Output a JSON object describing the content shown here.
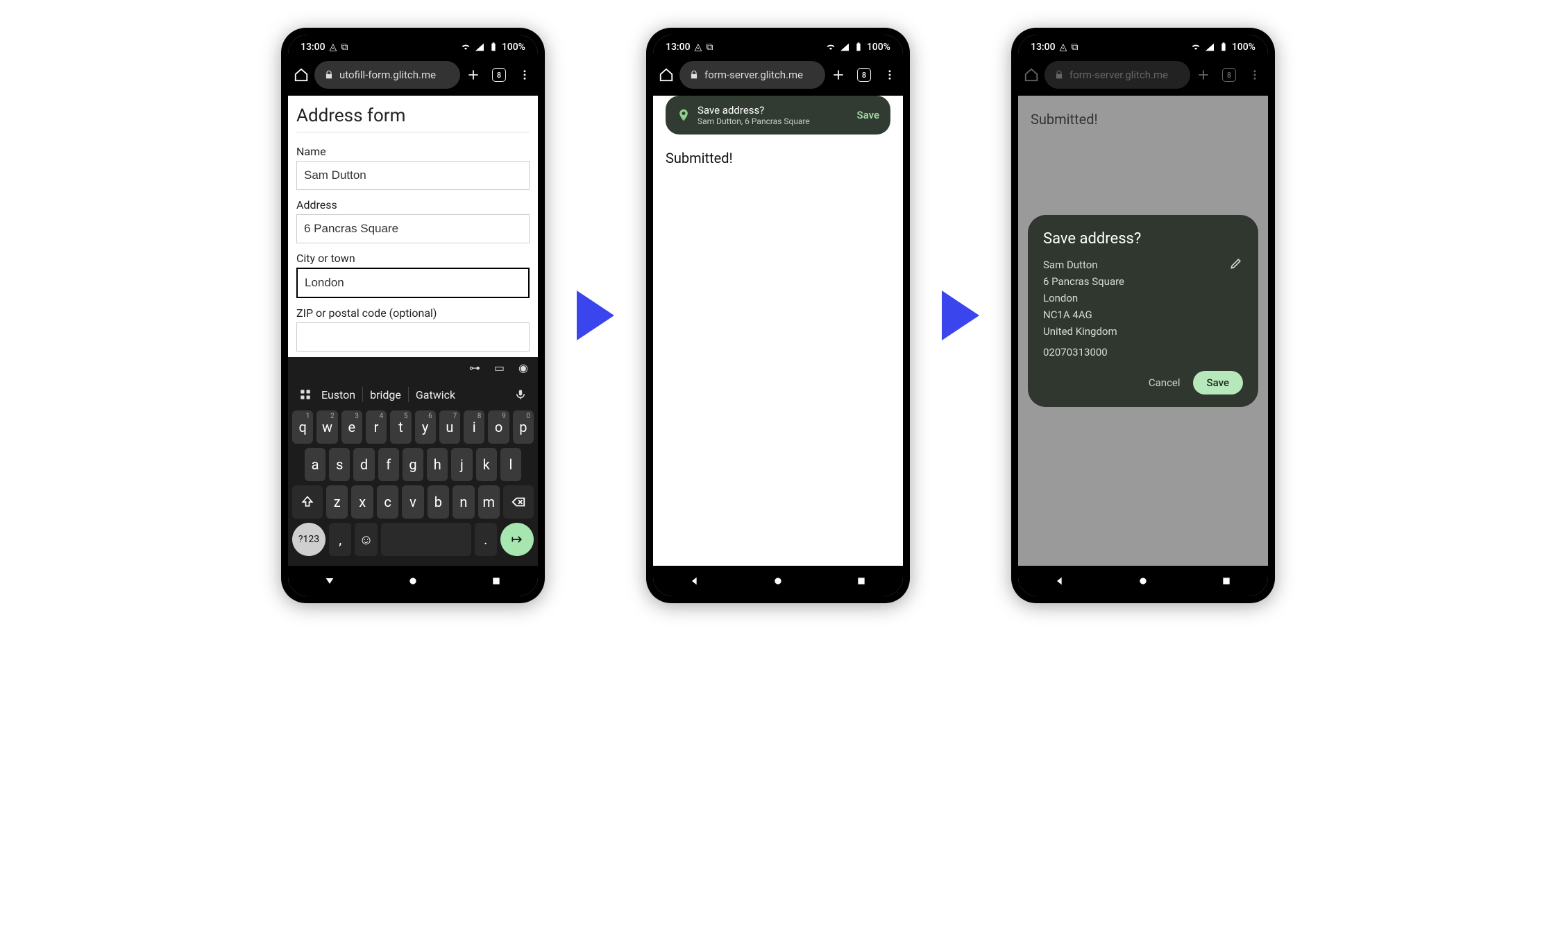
{
  "status": {
    "time": "13:00",
    "battery": "100%"
  },
  "tabs_count": "8",
  "phone1": {
    "url": "utofill-form.glitch.me",
    "form_title": "Address form",
    "fields": {
      "name": {
        "label": "Name",
        "value": "Sam Dutton"
      },
      "address": {
        "label": "Address",
        "value": "6 Pancras Square"
      },
      "city": {
        "label": "City or town",
        "value": "London"
      },
      "zip": {
        "label": "ZIP or postal code (optional)",
        "value": ""
      }
    },
    "keyboard": {
      "suggestions": [
        "Euston",
        "bridge",
        "Gatwick"
      ],
      "number_key": "?123",
      "row1": [
        {
          "k": "q",
          "n": "1"
        },
        {
          "k": "w",
          "n": "2"
        },
        {
          "k": "e",
          "n": "3"
        },
        {
          "k": "r",
          "n": "4"
        },
        {
          "k": "t",
          "n": "5"
        },
        {
          "k": "y",
          "n": "6"
        },
        {
          "k": "u",
          "n": "7"
        },
        {
          "k": "i",
          "n": "8"
        },
        {
          "k": "o",
          "n": "9"
        },
        {
          "k": "p",
          "n": "0"
        }
      ],
      "row2": [
        "a",
        "s",
        "d",
        "f",
        "g",
        "h",
        "j",
        "k",
        "l"
      ],
      "row3": [
        "z",
        "x",
        "c",
        "v",
        "b",
        "n",
        "m"
      ]
    }
  },
  "phone2": {
    "url": "form-server.glitch.me",
    "body_text": "Submitted!",
    "save_chip": {
      "title": "Save address?",
      "subtitle": "Sam Dutton, 6 Pancras Square",
      "action": "Save"
    }
  },
  "phone3": {
    "url": "form-server.glitch.me",
    "body_text": "Submitted!",
    "dialog": {
      "title": "Save address?",
      "lines": [
        "Sam Dutton",
        "6 Pancras Square",
        "London",
        "NC1A 4AG",
        "United Kingdom"
      ],
      "phone": "02070313000",
      "cancel": "Cancel",
      "save": "Save"
    }
  }
}
